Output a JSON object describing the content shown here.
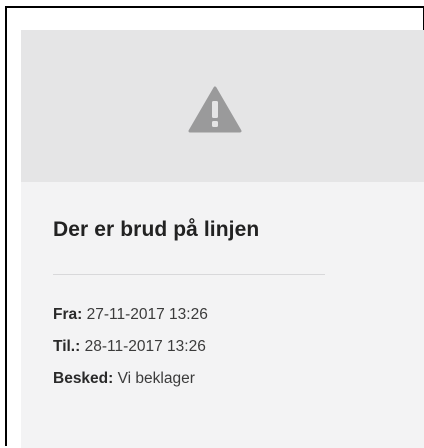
{
  "notice": {
    "icon": "warning-triangle-icon",
    "title": "Der er brud på linjen",
    "from_label": "Fra:",
    "from_value": "27-11-2017 13:26",
    "to_label": "Til.:",
    "to_value": "28-11-2017 13:26",
    "message_label": "Besked:",
    "message_value": "Vi beklager"
  },
  "colors": {
    "header_band": "#e5e5e6",
    "card_background": "#f3f3f4",
    "icon": "#9a9a9b",
    "text": "#2a2a2a"
  }
}
